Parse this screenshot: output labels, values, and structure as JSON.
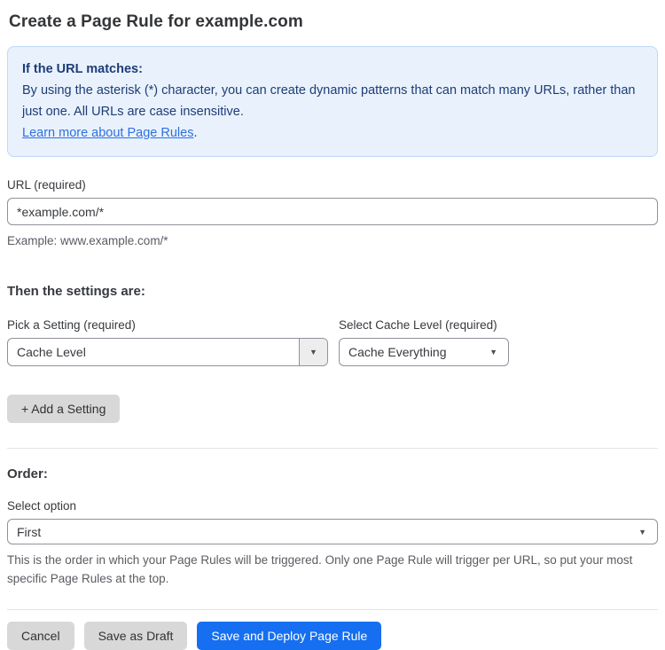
{
  "page": {
    "title": "Create a Page Rule for example.com"
  },
  "info_box": {
    "heading": "If the URL matches:",
    "body": "By using the asterisk (*) character, you can create dynamic patterns that can match many URLs, rather than just one. All URLs are case insensitive.",
    "link_label": "Learn more about Page Rules",
    "link_suffix": "."
  },
  "url_field": {
    "label": "URL (required)",
    "value": "*example.com/*",
    "help": "Example: www.example.com/*"
  },
  "settings": {
    "heading": "Then the settings are:",
    "setting_select": {
      "label": "Pick a Setting (required)",
      "value": "Cache Level"
    },
    "cache_level_select": {
      "label": "Select Cache Level (required)",
      "value": "Cache Everything"
    },
    "add_setting_label": "+ Add a Setting"
  },
  "order": {
    "heading": "Order:",
    "select_label": "Select option",
    "value": "First",
    "help": "This is the order in which your Page Rules will be triggered. Only one Page Rule will trigger per URL, so put your most specific Page Rules at the top."
  },
  "footer": {
    "cancel_label": "Cancel",
    "save_draft_label": "Save as Draft",
    "save_deploy_label": "Save and Deploy Page Rule"
  },
  "icons": {
    "dropdown_arrow": "▼"
  },
  "colors": {
    "accent_blue": "#156ff0",
    "info_bg": "#e9f2fc",
    "info_border": "#bed9f7",
    "info_text": "#1e3c78",
    "link_blue": "#2f6fe0",
    "button_gray": "#d8d8d8"
  }
}
